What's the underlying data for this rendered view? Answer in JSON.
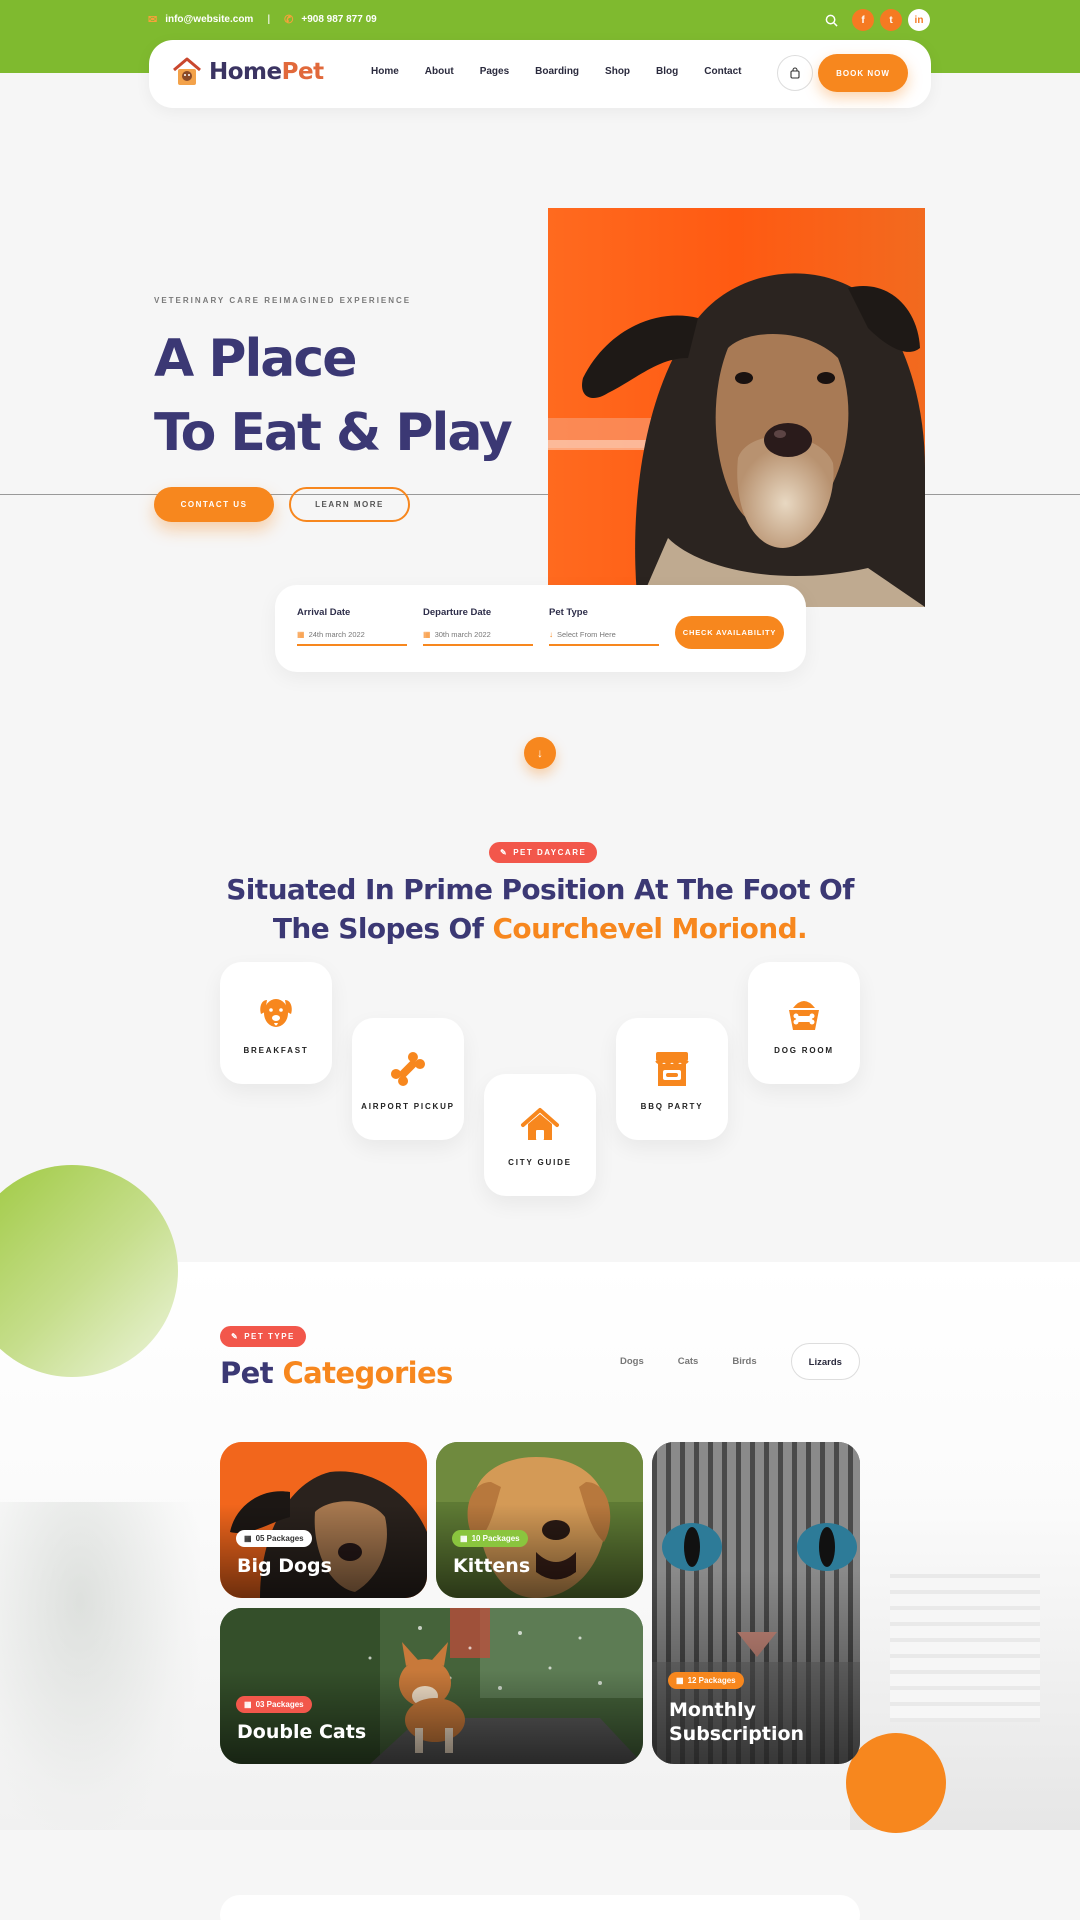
{
  "topbar": {
    "email": "info@website.com",
    "phone": "+908 987 877 09",
    "social": [
      "facebook-icon",
      "twitter-icon",
      "linkedin-icon"
    ],
    "social_glyphs": [
      "f",
      "t",
      "in"
    ]
  },
  "header": {
    "brand_part1": "Home",
    "brand_part2": "Pet",
    "menu": [
      "Home",
      "About",
      "Pages",
      "Boarding",
      "Shop",
      "Blog",
      "Contact"
    ],
    "book_now": "BOOK NOW"
  },
  "hero": {
    "eyebrow": "VETERINARY CARE REIMAGINED EXPERIENCE",
    "title_line1": "A Place",
    "title_line2": "To Eat & Play",
    "contact_btn": "CONTACT US",
    "learn_btn": "LEARN MORE"
  },
  "booking": {
    "arrival_label": "Arrival Date",
    "arrival_value": "24th march 2022",
    "departure_label": "Departure Date",
    "departure_value": "30th march 2022",
    "pettype_label": "Pet Type",
    "pettype_placeholder": "Select From Here",
    "check_btn": "CHECK AVAILABILITY"
  },
  "daycare": {
    "tag": "PET DAYCARE",
    "title_line1": "Situated In Prime Position At The Foot Of",
    "title_line2_plain": "The Slopes Of ",
    "title_line2_highlight": "Courchevel Moriond.",
    "features": [
      {
        "label": "BREAKFAST",
        "icon": "dog-face-icon"
      },
      {
        "label": "AIRPORT PICKUP",
        "icon": "bone-icon"
      },
      {
        "label": "CITY GUIDE",
        "icon": "house-icon"
      },
      {
        "label": "BBQ PARTY",
        "icon": "pet-shop-icon"
      },
      {
        "label": "DOG ROOM",
        "icon": "dog-bowl-icon"
      }
    ]
  },
  "categories": {
    "tag": "PET TYPE",
    "title_plain": "Pet ",
    "title_highlight": "Categories",
    "filters": [
      "Dogs",
      "Cats",
      "Birds",
      "Lizards"
    ],
    "active_filter": "Lizards",
    "cards": [
      {
        "name": "Big Dogs",
        "packages": "05 Packages"
      },
      {
        "name": "Kittens",
        "packages": "10 Packages"
      },
      {
        "name": "Double Cats",
        "packages": "03 Packages"
      },
      {
        "name_line1": "Monthly",
        "name_line2": "Subscription",
        "packages": "12 Packages"
      }
    ]
  },
  "colors": {
    "green": "#7fba2f",
    "orange": "#f7871e",
    "navy": "#3b3874",
    "red": "#f2574b"
  }
}
